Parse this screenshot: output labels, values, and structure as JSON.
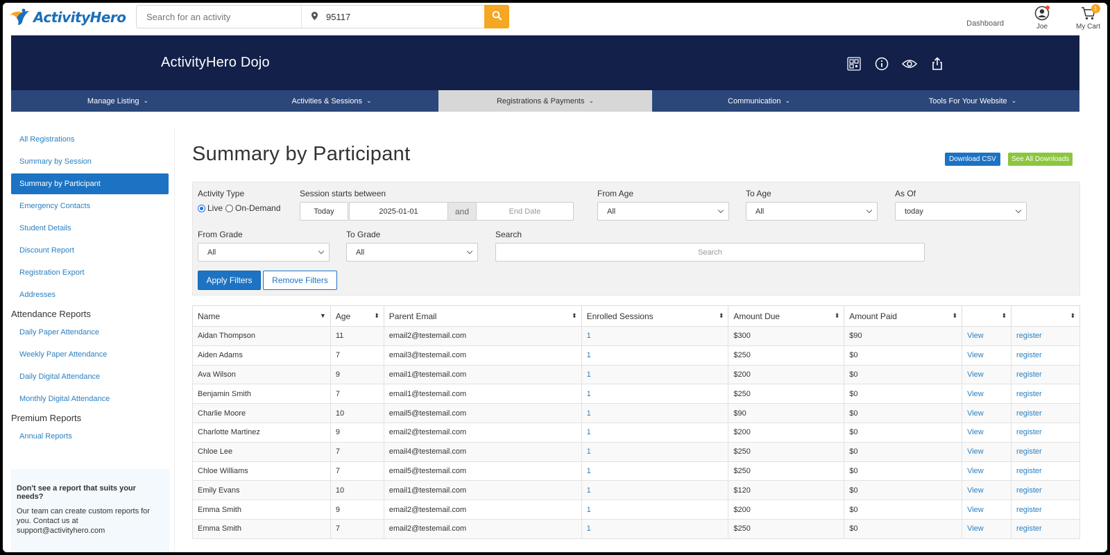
{
  "header": {
    "brand": "ActivityHero",
    "search_placeholder": "Search for an activity",
    "zip": "95117",
    "dashboard": "Dashboard",
    "user": "Joe",
    "cart": "My Cart",
    "cart_count": "1"
  },
  "hero": {
    "title": "ActivityHero Dojo"
  },
  "nav": [
    {
      "label": "Manage Listing"
    },
    {
      "label": "Activities & Sessions"
    },
    {
      "label": "Registrations & Payments"
    },
    {
      "label": "Communication"
    },
    {
      "label": "Tools For Your Website"
    }
  ],
  "sidebar": {
    "links": [
      {
        "label": "All Registrations"
      },
      {
        "label": "Summary by Session"
      },
      {
        "label": "Summary by Participant"
      },
      {
        "label": "Emergency Contacts"
      },
      {
        "label": "Student Details"
      },
      {
        "label": "Discount Report"
      },
      {
        "label": "Registration Export"
      },
      {
        "label": "Addresses"
      }
    ],
    "attendance_heading": "Attendance Reports",
    "attendance_links": [
      {
        "label": "Daily Paper Attendance"
      },
      {
        "label": "Weekly Paper Attendance"
      },
      {
        "label": "Daily Digital Attendance"
      },
      {
        "label": "Monthly Digital Attendance"
      }
    ],
    "premium_heading": "Premium Reports",
    "premium_links": [
      {
        "label": "Annual Reports"
      }
    ],
    "help_heading": "Don't see a report that suits your needs?",
    "help_body": "Our team can create custom reports for you. Contact us at support@activityhero.com"
  },
  "main": {
    "title": "Summary by Participant",
    "download_csv": "Download CSV",
    "see_all_downloads": "See All Downloads"
  },
  "filters": {
    "activity_type_label": "Activity Type",
    "live": "Live",
    "on_demand": "On-Demand",
    "session_label": "Session starts between",
    "today_btn": "Today",
    "start_date": "2025-01-01",
    "and": "and",
    "end_date_placeholder": "End Date",
    "from_age_label": "From Age",
    "from_age": "All",
    "to_age_label": "To Age",
    "to_age": "All",
    "as_of_label": "As Of",
    "as_of": "today",
    "from_grade_label": "From Grade",
    "from_grade": "All",
    "to_grade_label": "To Grade",
    "to_grade": "All",
    "search_label": "Search",
    "search_placeholder": "Search",
    "apply": "Apply Filters",
    "remove": "Remove Filters"
  },
  "table": {
    "headers": [
      "Name",
      "Age",
      "Parent Email",
      "Enrolled Sessions",
      "Amount Due",
      "Amount Paid",
      "",
      ""
    ],
    "rows": [
      {
        "name": "Aidan Thompson",
        "age": "11",
        "email": "email2@testemail.com",
        "sessions": "1",
        "due": "$300",
        "paid": "$90",
        "view": "View",
        "register": "register"
      },
      {
        "name": "Aiden Adams",
        "age": "7",
        "email": "email3@testemail.com",
        "sessions": "1",
        "due": "$250",
        "paid": "$0",
        "view": "View",
        "register": "register"
      },
      {
        "name": "Ava Wilson",
        "age": "9",
        "email": "email1@testemail.com",
        "sessions": "1",
        "due": "$200",
        "paid": "$0",
        "view": "View",
        "register": "register"
      },
      {
        "name": "Benjamin Smith",
        "age": "7",
        "email": "email1@testemail.com",
        "sessions": "1",
        "due": "$250",
        "paid": "$0",
        "view": "View",
        "register": "register"
      },
      {
        "name": "Charlie Moore",
        "age": "10",
        "email": "email5@testemail.com",
        "sessions": "1",
        "due": "$90",
        "paid": "$0",
        "view": "View",
        "register": "register"
      },
      {
        "name": "Charlotte Martinez",
        "age": "9",
        "email": "email2@testemail.com",
        "sessions": "1",
        "due": "$200",
        "paid": "$0",
        "view": "View",
        "register": "register"
      },
      {
        "name": "Chloe Lee",
        "age": "7",
        "email": "email4@testemail.com",
        "sessions": "1",
        "due": "$250",
        "paid": "$0",
        "view": "View",
        "register": "register"
      },
      {
        "name": "Chloe Williams",
        "age": "7",
        "email": "email5@testemail.com",
        "sessions": "1",
        "due": "$250",
        "paid": "$0",
        "view": "View",
        "register": "register"
      },
      {
        "name": "Emily Evans",
        "age": "10",
        "email": "email1@testemail.com",
        "sessions": "1",
        "due": "$120",
        "paid": "$0",
        "view": "View",
        "register": "register"
      },
      {
        "name": "Emma Smith",
        "age": "9",
        "email": "email2@testemail.com",
        "sessions": "1",
        "due": "$200",
        "paid": "$0",
        "view": "View",
        "register": "register"
      },
      {
        "name": "Emma Smith",
        "age": "7",
        "email": "email2@testemail.com",
        "sessions": "1",
        "due": "$250",
        "paid": "$0",
        "view": "View",
        "register": "register"
      }
    ]
  },
  "colors": {
    "brand_blue": "#1c6fb8",
    "hero_navy": "#12204a",
    "nav_blue": "#2b4679",
    "accent_orange": "#f5a623",
    "link_blue": "#2a7fc0",
    "green": "#8cc63f"
  }
}
